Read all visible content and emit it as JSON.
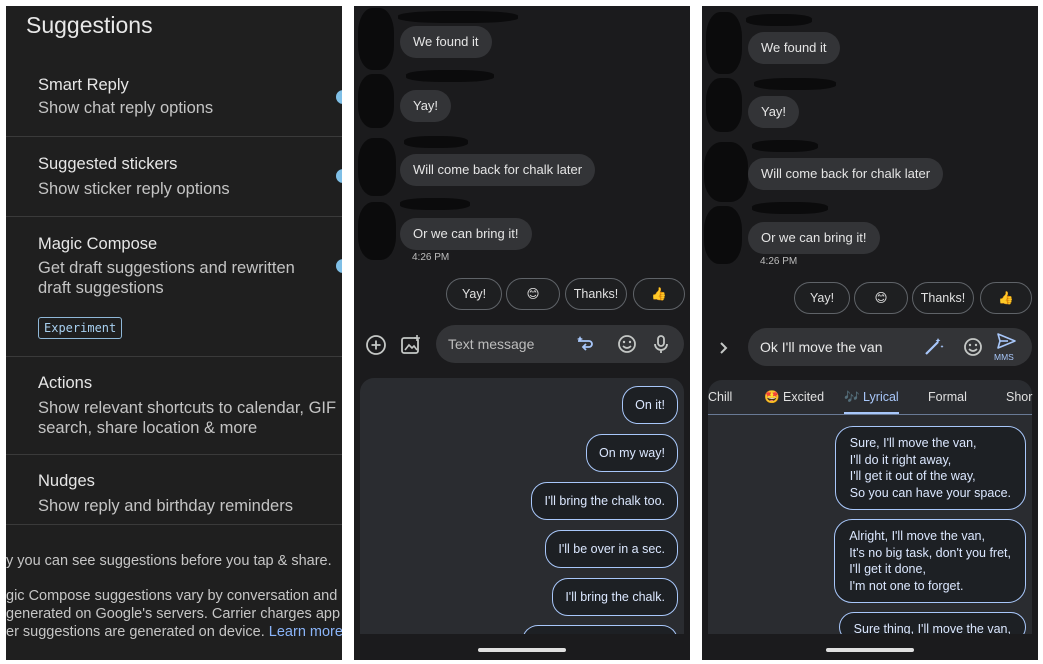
{
  "settings": {
    "title": "Suggestions",
    "items": [
      {
        "title": "Smart Reply",
        "desc": "Show chat reply options"
      },
      {
        "title": "Suggested stickers",
        "desc": "Show sticker reply options"
      },
      {
        "title": "Magic Compose",
        "desc": "Get draft suggestions and rewritten draft suggestions",
        "badge": "Experiment"
      },
      {
        "title": "Actions",
        "desc": "Show relevant shortcuts to calendar, GIF search, share location & more"
      },
      {
        "title": "Nudges",
        "desc": "Show reply and birthday reminders"
      }
    ],
    "footer1": "y you can see suggestions before you tap & share.",
    "footer2a": "gic Compose suggestions vary by conversation and",
    "footer2b": "generated on Google's servers. Carrier charges app",
    "footer2c": "er suggestions are generated on device.",
    "learn_more": "Learn more"
  },
  "chat": {
    "messages": [
      "We found it",
      "Yay!",
      "Will come back for chalk later",
      "Or we can bring it!"
    ],
    "time": "4:26 PM",
    "quick_replies": [
      "Yay!",
      "😊",
      "Thanks!",
      "👍"
    ]
  },
  "panel2": {
    "placeholder": "Text message",
    "suggestions": [
      "On it!",
      "On my way!",
      "I'll bring the chalk too.",
      "I'll be over in a sec.",
      "I'll bring the chalk."
    ]
  },
  "panel3": {
    "draft": "Ok I'll move the van",
    "send_label": "MMS",
    "tabs": [
      "Chill",
      "🤩 Excited",
      "🎶 Lyrical",
      "Formal",
      "Shor"
    ],
    "suggestions": [
      [
        "Sure, I'll move the van,",
        "I'll do it right away,",
        "I'll get it out of the way,",
        "So you can have your space."
      ],
      [
        "Alright, I'll move the van,",
        "It's no big task, don't you fret,",
        "I'll get it done,",
        "I'm not one to forget."
      ],
      [
        "Sure thing, I'll move the van,"
      ]
    ]
  },
  "colors": {
    "accent": "#a8c7fa",
    "link": "#8ab4f8",
    "toggle": "#7fbfe6"
  }
}
